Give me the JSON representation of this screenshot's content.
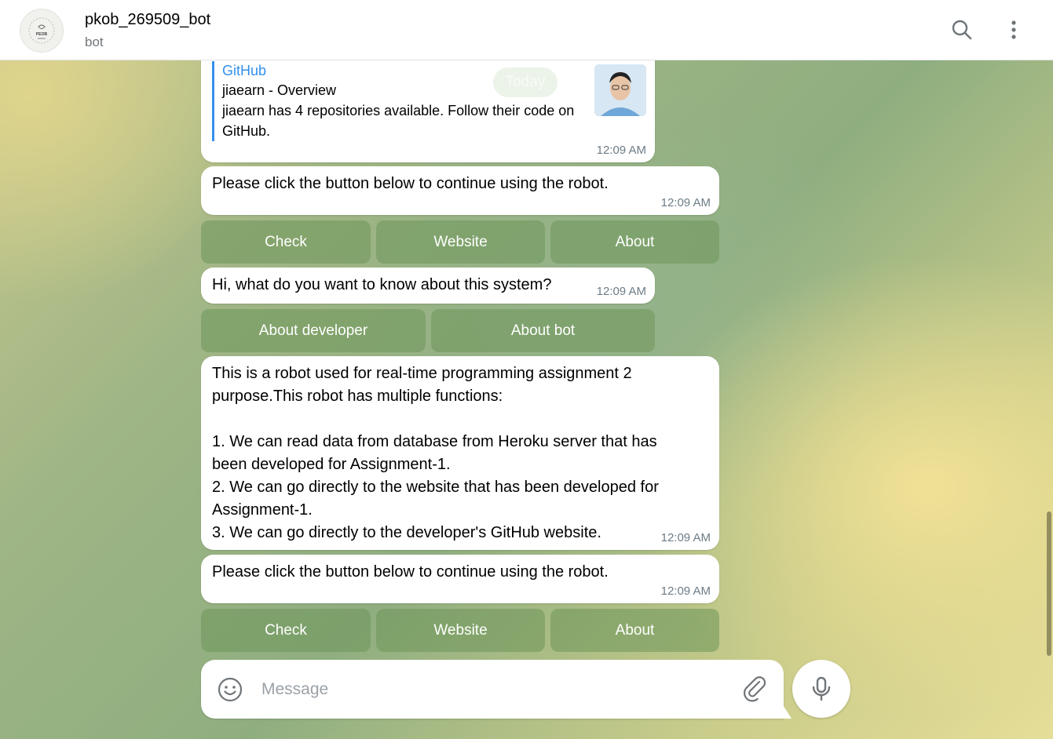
{
  "header": {
    "title": "pkob_269509_bot",
    "subtitle": "bot",
    "avatar_text": "PEOB"
  },
  "date_pill": "Today",
  "messages": {
    "m1": {
      "preview_site": "GitHub",
      "preview_title": "jiaearn - Overview",
      "preview_desc": "jiaearn has 4 repositories available. Follow their code on GitHub.",
      "time": "12:09 AM"
    },
    "m2": {
      "text": "Please click the button below to continue using the robot.",
      "time": "12:09 AM"
    },
    "kb1": [
      "Check",
      "Website",
      "About"
    ],
    "m3": {
      "text": "Hi, what do you want to know about this system?",
      "time": "12:09 AM"
    },
    "kb2": [
      "About developer",
      "About bot"
    ],
    "m4": {
      "lines": [
        "This is a robot used for real-time programming assignment 2",
        "purpose.This robot has multiple functions:",
        "",
        "1. We can read data from database from Heroku server that has",
        "been developed for Assignment-1.",
        "2. We can go directly to the website that has been developed for",
        "Assignment-1.",
        "3. We can go directly to the developer's GitHub website."
      ],
      "time": "12:09 AM"
    },
    "m5": {
      "text": "Please click the button below to continue using the robot.",
      "time": "12:09 AM"
    },
    "kb3": [
      "Check",
      "Website",
      "About"
    ]
  },
  "composer": {
    "placeholder": "Message"
  },
  "colors": {
    "accent": "#3390ec",
    "keyboard_button": "#7a9a63"
  },
  "icons": [
    "search-icon",
    "more-vertical-icon",
    "emoji-icon",
    "attach-icon",
    "microphone-icon"
  ]
}
